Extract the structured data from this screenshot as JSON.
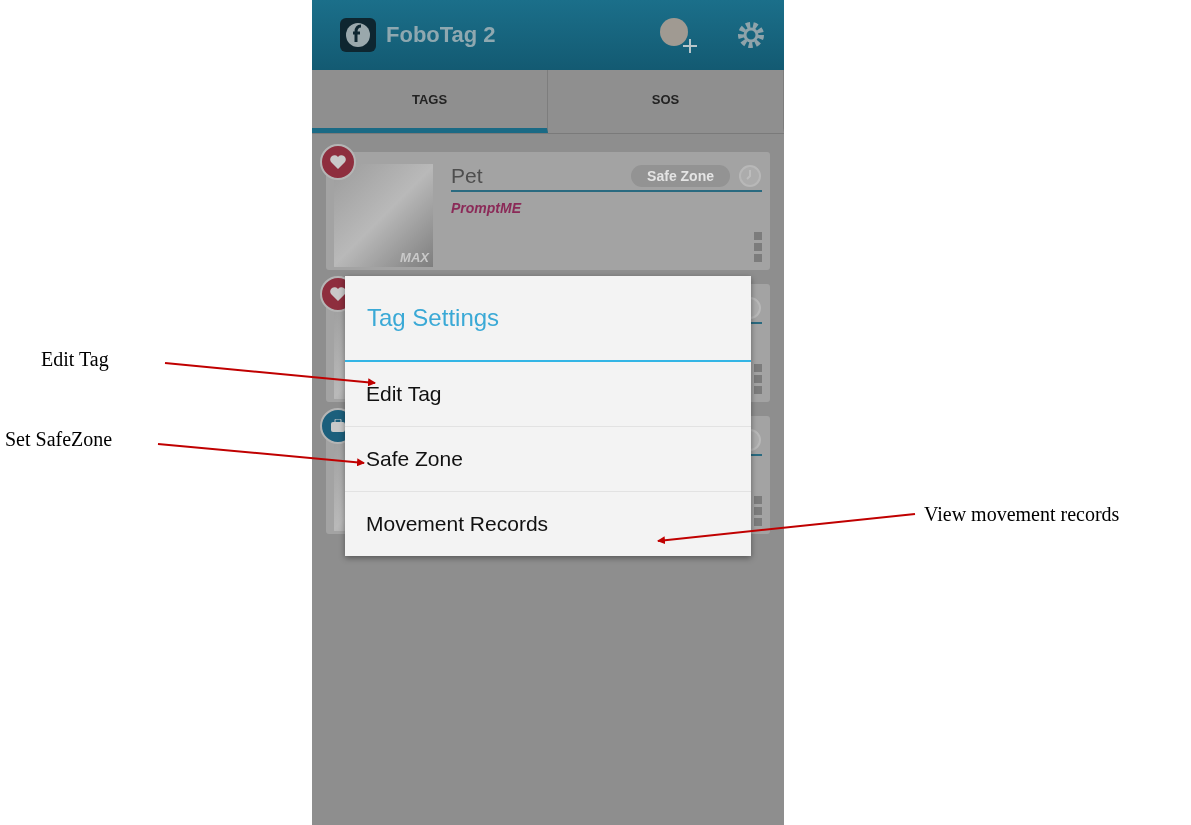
{
  "app_bar": {
    "title": "FoboTag 2"
  },
  "tabs": [
    {
      "label": "TAGS",
      "selected": true
    },
    {
      "label": "SOS",
      "selected": false
    }
  ],
  "tags": [
    {
      "kind": "pet",
      "name": "Pet",
      "owner": "PromptME",
      "photo_caption": "MAX",
      "safe_zone_label": "Safe Zone"
    },
    {
      "kind": "pet"
    },
    {
      "kind": "bag"
    }
  ],
  "dialog": {
    "title": "Tag Settings",
    "items": [
      "Edit Tag",
      "Safe Zone",
      "Movement Records"
    ]
  },
  "annotations": [
    {
      "text": "Edit Tag"
    },
    {
      "text": "Set SafeZone"
    },
    {
      "text": "View movement records"
    }
  ]
}
